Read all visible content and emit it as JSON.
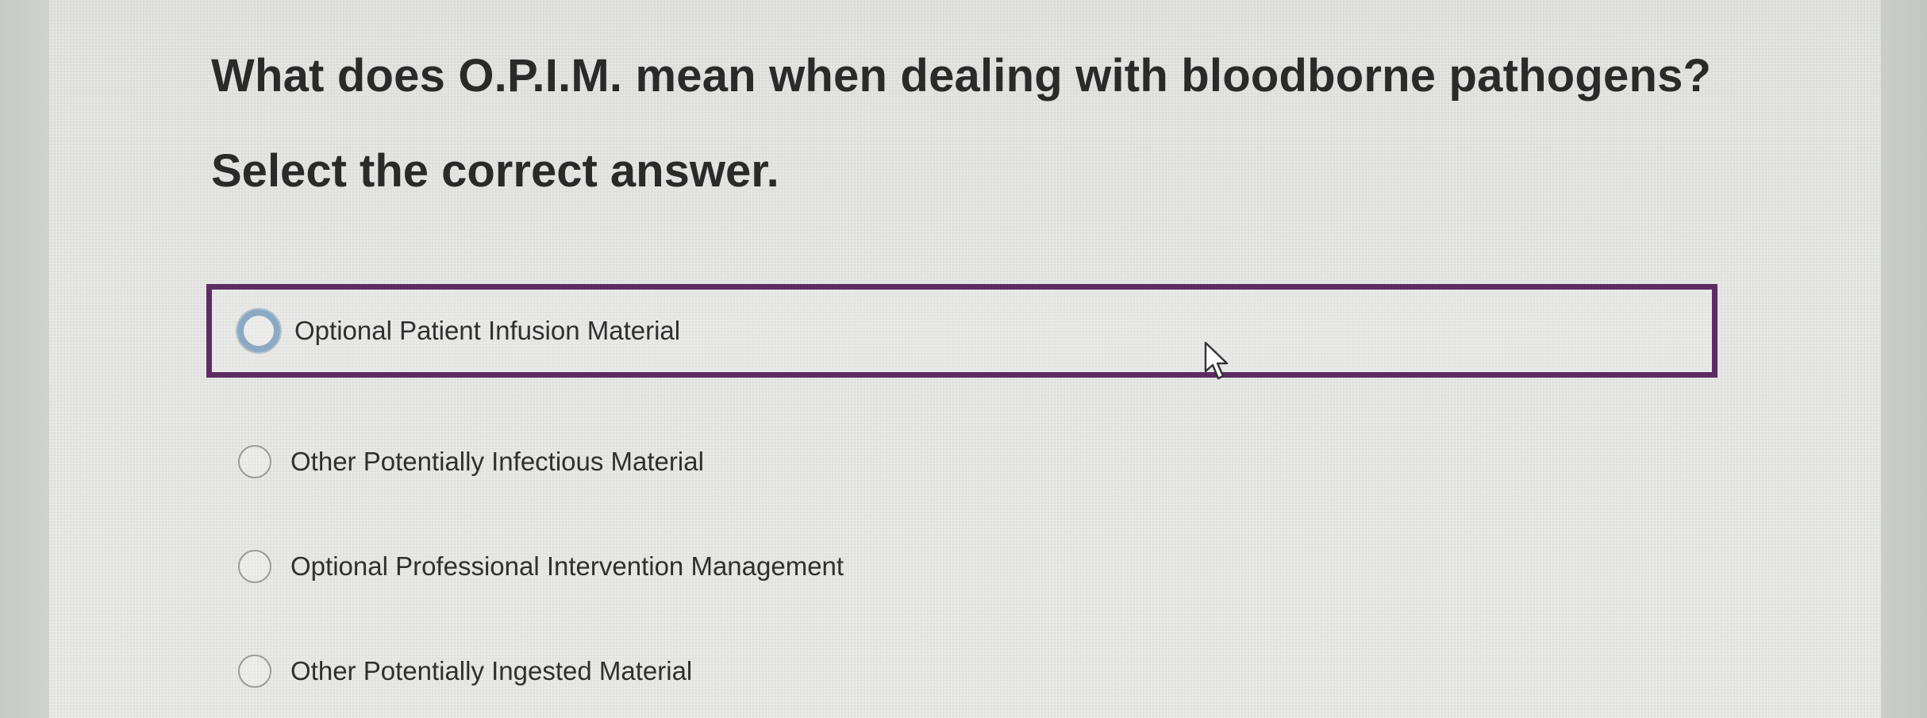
{
  "question": {
    "text": "What does O.P.I.M. mean when dealing with bloodborne pathogens?",
    "instruction": "Select the correct answer."
  },
  "options": [
    {
      "label": "Optional Patient Infusion Material",
      "focused": true
    },
    {
      "label": "Other Potentially Infectious Material",
      "focused": false
    },
    {
      "label": "Optional Professional Intervention Management",
      "focused": false
    },
    {
      "label": "Other Potentially Ingested Material",
      "focused": false
    }
  ],
  "colors": {
    "focus_border": "#5c2c62",
    "radio_focus_ring": "#8ba9c2",
    "text": "#2a2a2a"
  },
  "icons": {
    "cursor": "mouse-pointer-icon"
  }
}
